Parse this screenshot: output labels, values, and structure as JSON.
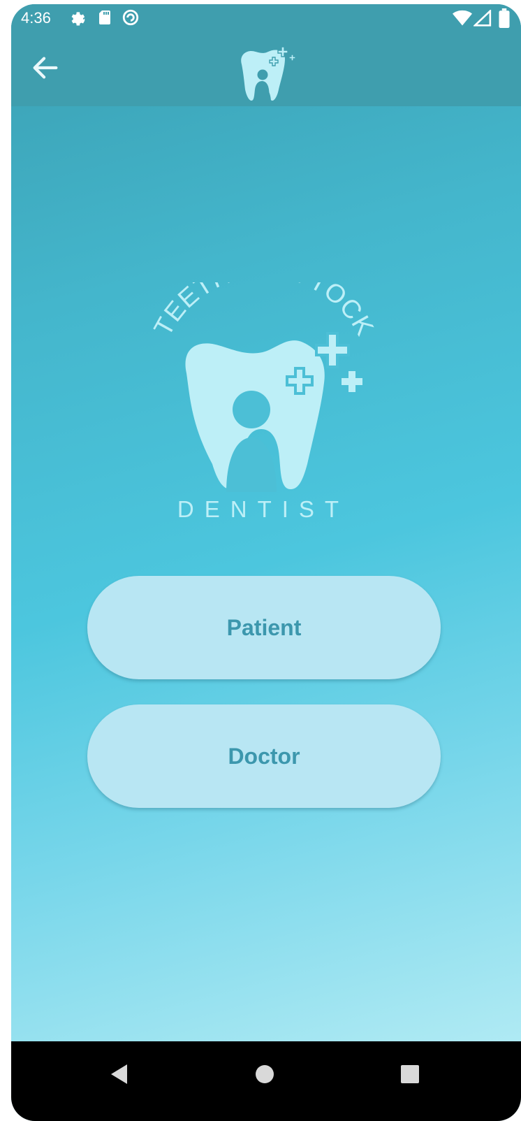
{
  "status_bar": {
    "time": "4:36",
    "left_icons": [
      "gear-icon",
      "sd-card-icon",
      "sync-icon"
    ],
    "right_icons": [
      "wifi-icon",
      "signal-icon",
      "battery-icon"
    ]
  },
  "app_bar": {
    "back_icon": "arrow-left-icon",
    "logo_icon": "tooth-logo-icon"
  },
  "logo": {
    "brand_name": "TEETH TICK TOCK",
    "tagline": "DENTIST"
  },
  "roles": {
    "patient_label": "Patient",
    "doctor_label": "Doctor"
  },
  "nav": {
    "back": "triangle-back-icon",
    "home": "circle-home-icon",
    "recents": "square-recents-icon"
  },
  "colors": {
    "app_bar": "#3f9eae",
    "gradient_top": "#3a9fb2",
    "gradient_mid": "#4cc6de",
    "gradient_bottom": "#bdeff7",
    "button_bg": "#b8e6f3",
    "button_text": "#3c97ad",
    "logo_fill": "#bdeff7"
  }
}
